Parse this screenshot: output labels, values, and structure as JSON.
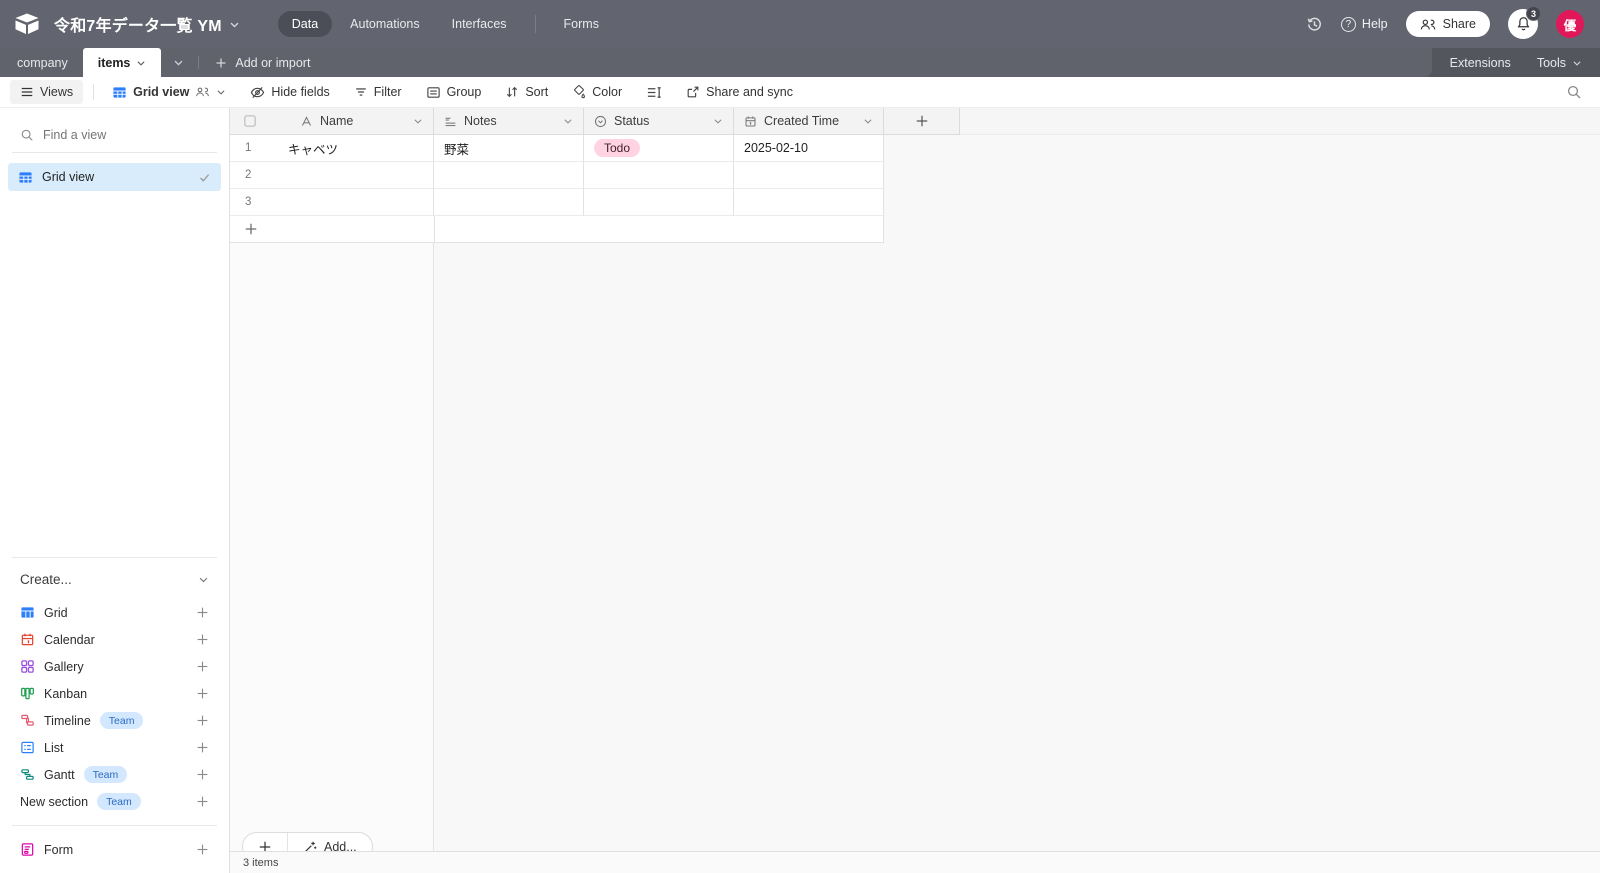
{
  "topbar": {
    "title": "令和7年データ一覧 YM",
    "tabs": [
      {
        "label": "Data",
        "active": true
      },
      {
        "label": "Automations",
        "active": false
      },
      {
        "label": "Interfaces",
        "active": false
      },
      {
        "label": "Forms",
        "active": false
      }
    ],
    "help_label": "Help",
    "help_glyph": "?",
    "share_label": "Share",
    "notification_count": "3",
    "avatar_initial": "優"
  },
  "tabbar": {
    "tables": [
      {
        "label": "company",
        "active": false
      },
      {
        "label": "items",
        "active": true
      }
    ],
    "add_or_import_label": "Add or import",
    "extensions_label": "Extensions",
    "tools_label": "Tools"
  },
  "toolbar": {
    "views_label": "Views",
    "view_name": "Grid view",
    "hide_fields_label": "Hide fields",
    "filter_label": "Filter",
    "group_label": "Group",
    "sort_label": "Sort",
    "color_label": "Color",
    "share_sync_label": "Share and sync"
  },
  "sidebar": {
    "find_placeholder": "Find a view",
    "selected_view": "Grid view",
    "create_label": "Create...",
    "create_items": [
      {
        "label": "Grid"
      },
      {
        "label": "Calendar"
      },
      {
        "label": "Gallery"
      },
      {
        "label": "Kanban"
      },
      {
        "label": "Timeline",
        "badge": "Team"
      },
      {
        "label": "List"
      },
      {
        "label": "Gantt",
        "badge": "Team"
      },
      {
        "label": "New section",
        "badge": "Team"
      },
      {
        "label": "Form"
      }
    ]
  },
  "grid": {
    "columns": [
      {
        "label": "Name"
      },
      {
        "label": "Notes"
      },
      {
        "label": "Status"
      },
      {
        "label": "Created Time"
      }
    ],
    "rows": [
      {
        "num": "1",
        "name": "キャベツ",
        "notes": "野菜",
        "status": "Todo",
        "created": "2025-02-10"
      },
      {
        "num": "2",
        "name": "",
        "notes": "",
        "status": "",
        "created": ""
      },
      {
        "num": "3",
        "name": "",
        "notes": "",
        "status": "",
        "created": ""
      }
    ],
    "add_row_label": "Add...",
    "summary": "3 items"
  },
  "colors": {
    "accent_blue": "#2d7ff9",
    "status_todo_bg": "#ffd3e1",
    "avatar_bg": "#e0185a",
    "selected_view_bg": "#d8ecfb",
    "team_badge_bg": "#d3e7fe"
  }
}
